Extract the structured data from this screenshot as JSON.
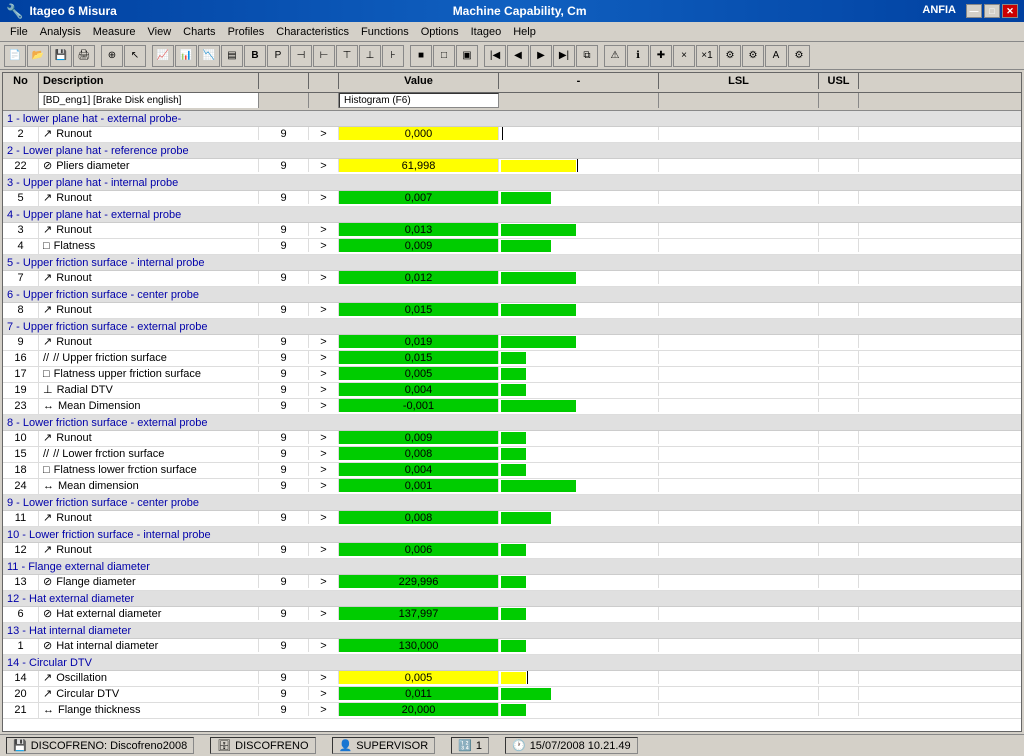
{
  "titlebar": {
    "left": "Itageo 6 Misura",
    "center": "Machine Capability, Cm",
    "right_app": "ANFIA",
    "win_min": "—",
    "win_max": "□",
    "win_close": "✕"
  },
  "menubar": {
    "items": [
      "File",
      "Analysis",
      "Measure",
      "View",
      "Charts",
      "Profiles",
      "Characteristics",
      "Functions",
      "Options",
      "Itageo",
      "Help"
    ]
  },
  "columns": {
    "no": "No",
    "description": "Description",
    "val1": "",
    "val2": "",
    "value": "Value",
    "dash": "-",
    "lsl": "LSL",
    "usl": "USL",
    "plus": "+"
  },
  "filter_row": {
    "dataset": "[BD_eng1] [Brake Disk english]",
    "histogram": "Histogram (F6)"
  },
  "sections": [
    {
      "id": "s1",
      "label": "1 - lower plane hat - external probe-",
      "rows": [
        {
          "no": "2",
          "icon": "↗",
          "desc": "Runout",
          "n": "9",
          "gt": ">",
          "value": "0,000",
          "val_type": "yellow",
          "bar_lsl": 0,
          "bar_usl": 0,
          "bar_type": "none",
          "has_lsl_line": true
        }
      ]
    },
    {
      "id": "s2",
      "label": "2 - Lower plane hat - reference probe",
      "rows": [
        {
          "no": "22",
          "icon": "⊘",
          "desc": "Pliers diameter",
          "n": "9",
          "gt": ">",
          "value": "61,998",
          "val_type": "yellow",
          "bar_lsl": 60,
          "bar_usl": 0,
          "bar_type": "yellow_long",
          "has_lsl_line": true
        }
      ]
    },
    {
      "id": "s3",
      "label": "3 - Upper plane hat - internal probe",
      "rows": [
        {
          "no": "5",
          "icon": "↗",
          "desc": "Runout",
          "n": "9",
          "gt": ">",
          "value": "0,007",
          "val_type": "green",
          "bar_lsl": 45,
          "bar_usl": 0,
          "bar_type": "green_mid"
        }
      ]
    },
    {
      "id": "s4",
      "label": "4 - Upper plane hat - external probe",
      "rows": [
        {
          "no": "3",
          "icon": "↗",
          "desc": "Runout",
          "n": "9",
          "gt": ">",
          "value": "0,013",
          "val_type": "green",
          "bar_lsl": 70,
          "bar_type": "green_long"
        },
        {
          "no": "4",
          "icon": "□",
          "desc": "Flatness",
          "n": "9",
          "gt": ">",
          "value": "0,009",
          "val_type": "green",
          "bar_lsl": 55,
          "bar_type": "green_mid"
        }
      ]
    },
    {
      "id": "s5",
      "label": "5 - Upper friction surface - internal probe",
      "rows": [
        {
          "no": "7",
          "icon": "↗",
          "desc": "Runout",
          "n": "9",
          "gt": ">",
          "value": "0,012",
          "val_type": "green",
          "bar_lsl": 65,
          "bar_type": "green_long"
        }
      ]
    },
    {
      "id": "s6",
      "label": "6 - Upper friction surface - center probe",
      "rows": [
        {
          "no": "8",
          "icon": "↗",
          "desc": "Runout",
          "n": "9",
          "gt": ">",
          "value": "0,015",
          "val_type": "green",
          "bar_lsl": 72,
          "bar_type": "green_long"
        }
      ]
    },
    {
      "id": "s7",
      "label": "7 - Upper friction surface - external probe",
      "rows": [
        {
          "no": "9",
          "icon": "↗",
          "desc": "Runout",
          "n": "9",
          "gt": ">",
          "value": "0,019",
          "val_type": "green",
          "bar_lsl": 80,
          "bar_type": "green_long"
        },
        {
          "no": "16",
          "icon": "//",
          "desc": "// Upper friction surface",
          "n": "9",
          "gt": ">",
          "value": "0,015",
          "val_type": "green",
          "bar_lsl": 35,
          "bar_type": "green_short"
        },
        {
          "no": "17",
          "icon": "□",
          "desc": "Flatness upper friction surface",
          "n": "9",
          "gt": ">",
          "value": "0,005",
          "val_type": "green",
          "bar_lsl": 20,
          "bar_type": "green_short"
        },
        {
          "no": "19",
          "icon": "⊥",
          "desc": "Radial DTV",
          "n": "9",
          "gt": ">",
          "value": "0,004",
          "val_type": "green",
          "bar_lsl": 18,
          "bar_type": "green_short"
        },
        {
          "no": "23",
          "icon": "↔",
          "desc": "Mean Dimension",
          "n": "9",
          "gt": ">",
          "value": "-0,001",
          "val_type": "green",
          "bar_lsl": 65,
          "bar_type": "green_long"
        }
      ]
    },
    {
      "id": "s8",
      "label": "8 - Lower friction surface - external probe",
      "rows": [
        {
          "no": "10",
          "icon": "↗",
          "desc": "Runout",
          "n": "9",
          "gt": ">",
          "value": "0,009",
          "val_type": "green",
          "bar_lsl": 22,
          "bar_type": "green_short"
        },
        {
          "no": "15",
          "icon": "//",
          "desc": "// Lower frction surface",
          "n": "9",
          "gt": ">",
          "value": "0,008",
          "val_type": "green",
          "bar_lsl": 18,
          "bar_type": "green_short"
        },
        {
          "no": "18",
          "icon": "□",
          "desc": "Flatness lower frction surface",
          "n": "9",
          "gt": ">",
          "value": "0,004",
          "val_type": "green",
          "bar_lsl": 12,
          "bar_type": "green_short"
        },
        {
          "no": "24",
          "icon": "↔",
          "desc": "Mean dimension",
          "n": "9",
          "gt": ">",
          "value": "0,001",
          "val_type": "green",
          "bar_lsl": 62,
          "bar_type": "green_long"
        }
      ]
    },
    {
      "id": "s9",
      "label": "9 - Lower friction surface - center probe",
      "rows": [
        {
          "no": "11",
          "icon": "↗",
          "desc": "Runout",
          "n": "9",
          "gt": ">",
          "value": "0,008",
          "val_type": "green",
          "bar_lsl": 48,
          "bar_type": "green_mid"
        }
      ]
    },
    {
      "id": "s10",
      "label": "10 - Lower friction surface - internal probe",
      "rows": [
        {
          "no": "12",
          "icon": "↗",
          "desc": "Runout",
          "n": "9",
          "gt": ">",
          "value": "0,006",
          "val_type": "green",
          "bar_lsl": 30,
          "bar_type": "green_short"
        }
      ]
    },
    {
      "id": "s11",
      "label": "11 - Flange external diameter",
      "rows": [
        {
          "no": "13",
          "icon": "⊘",
          "desc": "Flange diameter",
          "n": "9",
          "gt": ">",
          "value": "229,996",
          "val_type": "green",
          "bar_lsl": 30,
          "bar_type": "green_short"
        }
      ]
    },
    {
      "id": "s12",
      "label": "12 - Hat external diameter",
      "rows": [
        {
          "no": "6",
          "icon": "⊘",
          "desc": "Hat external diameter",
          "n": "9",
          "gt": ">",
          "value": "137,997",
          "val_type": "green",
          "bar_lsl": 30,
          "bar_type": "green_short"
        }
      ]
    },
    {
      "id": "s13",
      "label": "13 - Hat internal diameter",
      "rows": [
        {
          "no": "1",
          "icon": "⊘",
          "desc": "Hat internal diameter",
          "n": "9",
          "gt": ">",
          "value": "130,000",
          "val_type": "green",
          "bar_lsl": 30,
          "bar_type": "green_short"
        }
      ]
    },
    {
      "id": "s14",
      "label": "14 - Circular DTV",
      "rows": [
        {
          "no": "14",
          "icon": "↗",
          "desc": "Oscillation",
          "n": "9",
          "gt": ">",
          "value": "0,005",
          "val_type": "yellow",
          "bar_lsl": 5,
          "bar_type": "yellow_short",
          "has_lsl_line": true
        },
        {
          "no": "20",
          "icon": "↗",
          "desc": "Circular DTV",
          "n": "9",
          "gt": ">",
          "value": "0,011",
          "val_type": "green",
          "bar_lsl": 55,
          "bar_type": "green_mid"
        },
        {
          "no": "21",
          "icon": "↔",
          "desc": "Flange thickness",
          "n": "9",
          "gt": ">",
          "value": "20,000",
          "val_type": "green",
          "bar_lsl": 30,
          "bar_type": "green_short"
        }
      ]
    }
  ],
  "statusbar": {
    "disk_icon": "💾",
    "dataset": "DISCOFRENO: Discofreno2008",
    "db_icon": "🗄",
    "db_name": "DISCOFRENO",
    "user_icon": "👤",
    "user": "SUPERVISOR",
    "count_icon": "🔢",
    "count": "1",
    "clock_icon": "🕐",
    "datetime": "15/07/2008  10.21.49"
  }
}
